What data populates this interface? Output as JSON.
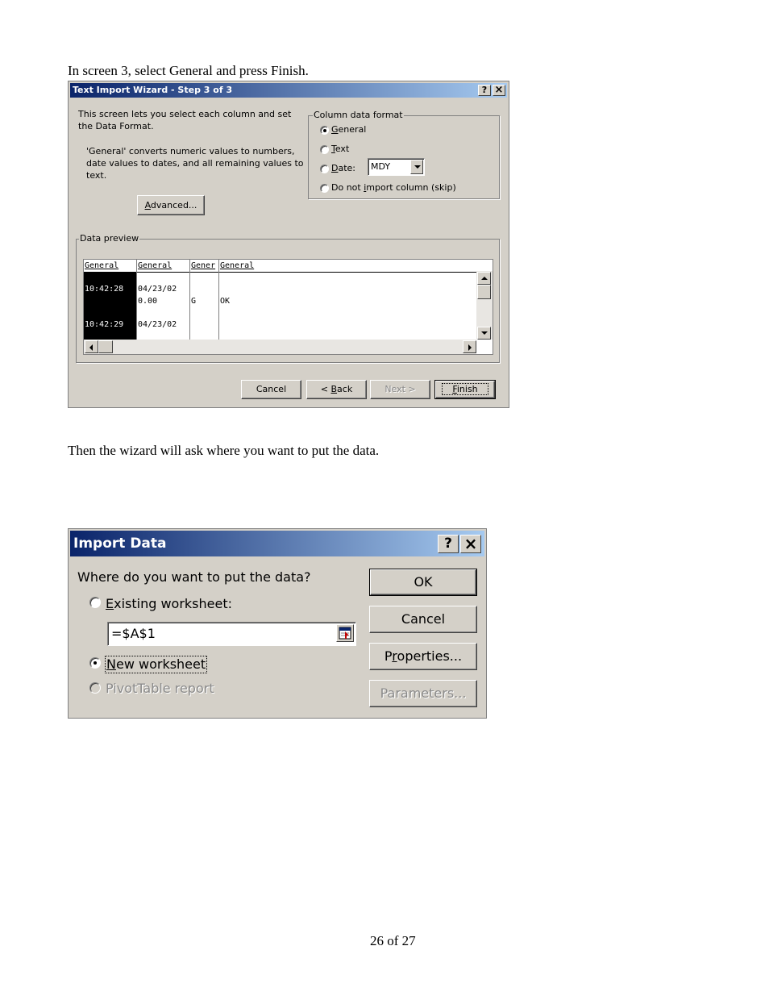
{
  "doc": {
    "intro": "In screen 3, select General and press Finish.",
    "middle": "Then the wizard will ask where you want to put the data.",
    "page_number": "26 of 27"
  },
  "wizard": {
    "title": "Text Import Wizard - Step 3 of 3",
    "help_glyph": "?",
    "close_glyph": "×",
    "desc1_line1": "This screen lets you select each column and set",
    "desc1_line2": "the Data Format.",
    "desc2_line1": "'General' converts numeric values to numbers,",
    "desc2_line2": "date values to dates, and all remaining values to",
    "desc2_line3": "text.",
    "advanced_a": "A",
    "advanced_rest": "dvanced...",
    "format_group": {
      "label": "Column data format",
      "general_a": "G",
      "general_rest": "eneral",
      "text_a": "T",
      "text_rest": "ext",
      "date_a": "D",
      "date_rest": "ate:",
      "date_value": "MDY",
      "skip_pre": "Do not ",
      "skip_a": "i",
      "skip_rest": "mport column (skip)"
    },
    "preview": {
      "label": "Data preview",
      "headers": [
        "General",
        "General",
        "Gener",
        "General"
      ],
      "rows": [
        [
          "10:42:28",
          "04/23/02",
          "",
          ""
        ],
        [
          "",
          "0.00",
          "G",
          "OK"
        ],
        [
          "10:42:29",
          "04/23/02",
          "",
          ""
        ]
      ]
    },
    "buttons": {
      "cancel": "Cancel",
      "back_pre": "< ",
      "back_a": "B",
      "back_rest": "ack",
      "next": "Next >",
      "finish_a": "F",
      "finish_rest": "inish"
    }
  },
  "import": {
    "title": "Import Data",
    "help_glyph": "?",
    "close_glyph": "×",
    "question": "Where do you want to put the data?",
    "existing_a": "E",
    "existing_rest": "xisting worksheet:",
    "range_value": "=$A$1",
    "new_a": "N",
    "new_rest": "ew worksheet",
    "pivot": "PivotTable report",
    "buttons": {
      "ok": "OK",
      "cancel": "Cancel",
      "properties_pre": "P",
      "properties_r": "r",
      "properties_rest": "operties...",
      "parameters": "Parameters..."
    }
  },
  "colors": {
    "title_start": "#0a246a",
    "title_end": "#a6caf0",
    "face": "#d4d0c8"
  }
}
